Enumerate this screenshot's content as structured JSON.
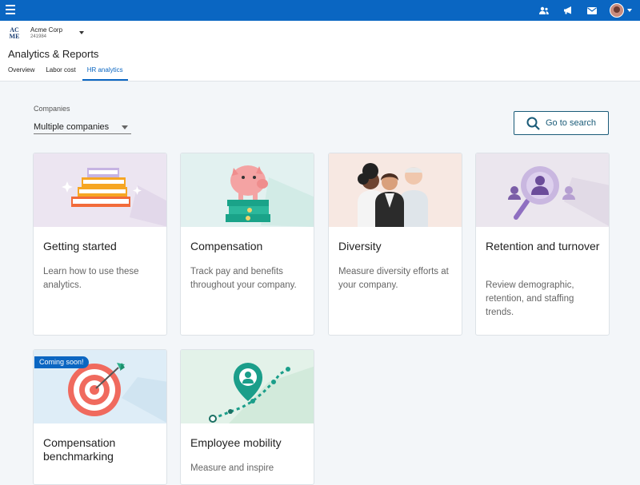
{
  "topbar": {
    "icons": [
      "menu-icon",
      "people-icon",
      "megaphone-icon",
      "mail-icon",
      "avatar"
    ]
  },
  "header": {
    "logo_line1": "AC",
    "logo_line2": "ME",
    "company_name": "Acme Corp",
    "company_id": "241984",
    "page_title": "Analytics & Reports",
    "tabs": [
      {
        "label": "Overview"
      },
      {
        "label": "Labor cost"
      },
      {
        "label": "HR analytics",
        "active": true
      }
    ]
  },
  "filter": {
    "label": "Companies",
    "selected": "Multiple companies"
  },
  "search_button": {
    "label": "Go to search"
  },
  "cards": [
    {
      "title": "Getting started",
      "description": "Learn how to use these analytics.",
      "art": "books",
      "color": "#ece5f1"
    },
    {
      "title": "Compensation",
      "description": "Track pay and benefits throughout your company.",
      "art": "piggy-bank",
      "color": "#e2f1f0"
    },
    {
      "title": "Diversity",
      "description": "Measure diversity efforts at your company.",
      "art": "people",
      "color": "#f7e8e2"
    },
    {
      "title": "Retention and turnover",
      "description": "Review demographic, retention, and staffing trends.",
      "art": "magnifier-person",
      "color": "#ebe6ee"
    },
    {
      "title": "Compensation benchmarking",
      "description": "",
      "art": "target",
      "color": "#deedf7",
      "badge": "Coming soon!"
    },
    {
      "title": "Employee mobility",
      "description": "Measure and inspire",
      "art": "map-pin-path",
      "color": "#e3f2e9"
    }
  ],
  "colors": {
    "accent": "#0a66c2",
    "search_border": "#1a5b78",
    "page_bg": "#f3f6f9"
  }
}
